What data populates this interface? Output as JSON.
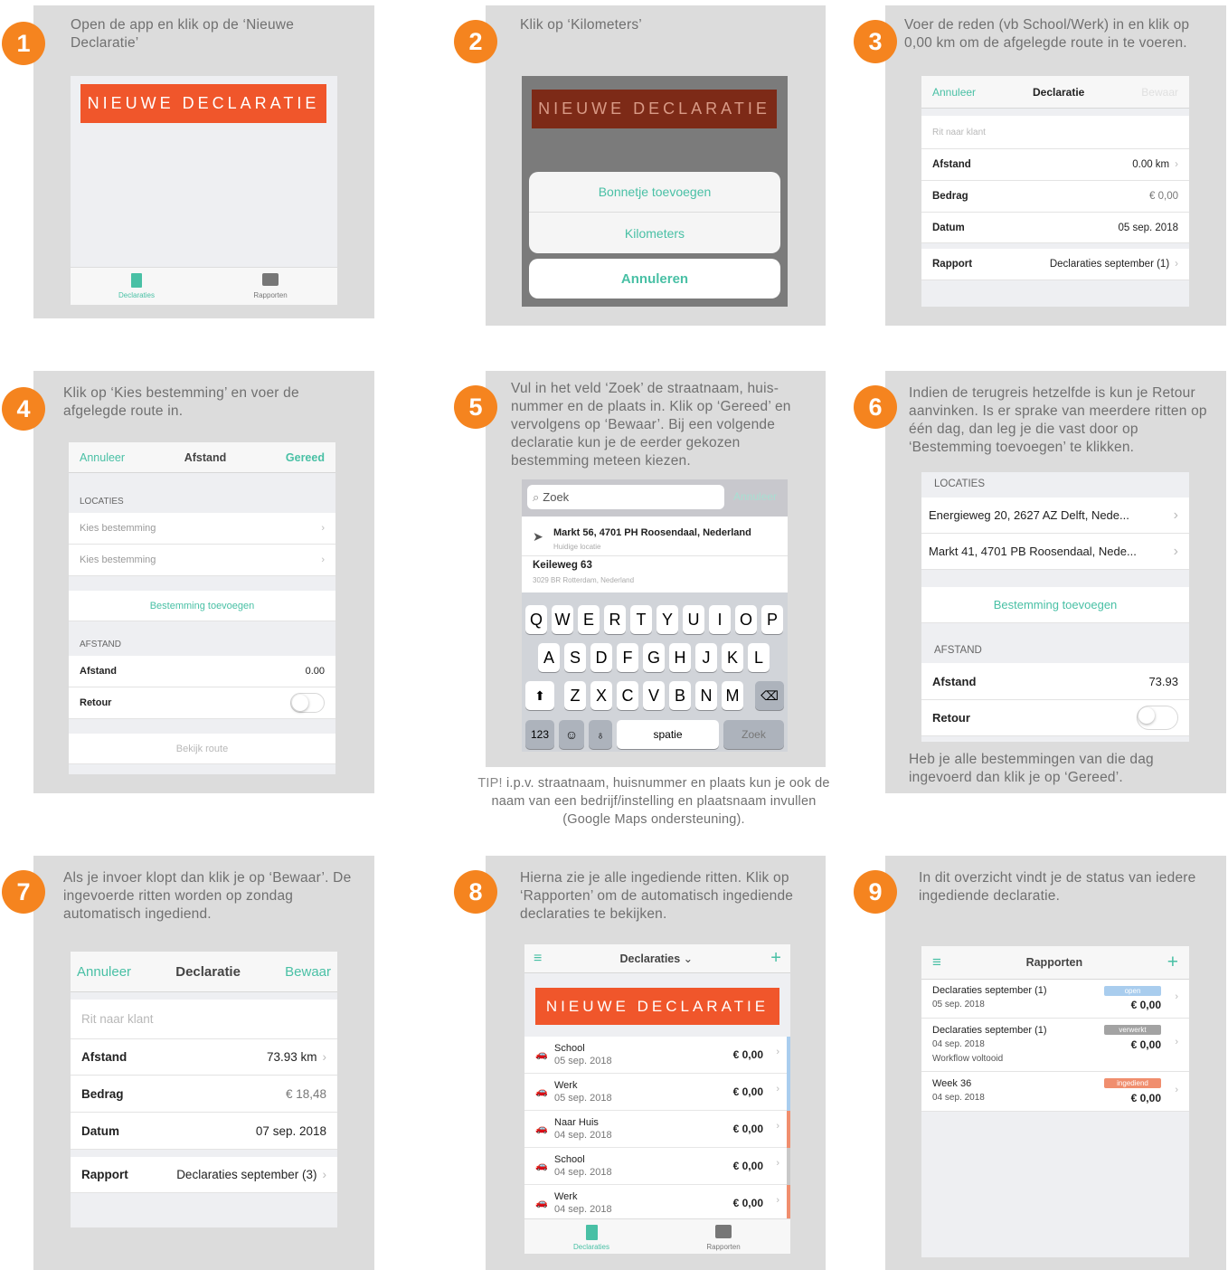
{
  "steps": [
    {
      "num": "1",
      "text": "Open de app en klik op de ‘Nieuwe Declaratie’"
    },
    {
      "num": "2",
      "text": "Klik op ‘Kilometers’"
    },
    {
      "num": "3",
      "text": "Voer de reden (vb School/Werk) in en klik op 0,00 km om de afgelegde route in te voeren."
    },
    {
      "num": "4",
      "text": "Klik op ‘Kies bestemming’ en voer de afgelegde route in."
    },
    {
      "num": "5",
      "text": "Vul in het veld ‘Zoek’ de straatnaam, huis-nummer en de plaats in. Klik op ‘Gereed’ en vervolgens op ‘Bewaar’. Bij een volgende declaratie kun je de eerder gekozen bestemming meteen kiezen."
    },
    {
      "num": "6",
      "text": "Indien de terugreis hetzelfde is kun je Retour aanvinken. Is er sprake van meerdere ritten op één dag, dan leg je die vast door op ‘Bestemming toevoegen’ te klikken.",
      "footer": "Heb je alle bestemmingen van die dag ingevoerd dan klik je op ‘Gereed’."
    },
    {
      "num": "7",
      "text": "Als je invoer klopt dan klik je op ‘Bewaar’. De ingevoerde ritten worden op zondag automatisch ingediend."
    },
    {
      "num": "8",
      "text": "Hierna zie je alle ingediende ritten. Klik op ‘Rapporten’ om de automatisch ingediende declaraties te bekijken."
    },
    {
      "num": "9",
      "text": "In dit overzicht vindt je de status van iedere ingediende declaratie."
    }
  ],
  "tip": {
    "bold": "TIP!",
    "text": " i.p.v. straatnaam, huisnummer en plaats kun je ook de naam van een bedrijf/instelling en plaatsnaam invullen (Google Maps ondersteuning)."
  },
  "app": {
    "new_btn": "NIEUWE DECLARATIE",
    "tab_declaraties": "Declaraties",
    "tab_rapporten": "Rapporten",
    "sheet": {
      "receipt": "Bonnetje toevoegen",
      "km": "Kilometers",
      "cancel": "Annuleren"
    },
    "form3": {
      "cancel": "Annuleer",
      "title": "Declaratie",
      "save": "Bewaar",
      "placeholder": "Rit naar klant",
      "afstand": "Afstand",
      "afstand_val": "0.00 km",
      "bedrag": "Bedrag",
      "bedrag_val": "€ 0,00",
      "datum": "Datum",
      "datum_val": "05 sep. 2018",
      "rapport": "Rapport",
      "rapport_val": "Declaraties september (1)"
    },
    "form4": {
      "cancel": "Annuleer",
      "title": "Afstand",
      "done": "Gereed",
      "locaties": "LOCATIES",
      "dest1": "Kies bestemming",
      "dest2": "Kies bestemming",
      "add": "Bestemming toevoegen",
      "afstand_h": "AFSTAND",
      "afstand": "Afstand",
      "afstand_val": "0.00",
      "retour": "Retour",
      "route": "Bekijk route"
    },
    "search5": {
      "placeholder": "Zoek",
      "cancel": "Annuleer",
      "r1": "Markt 56, 4701 PH Roosendaal, Nederland",
      "r1s": "Huidige locatie",
      "r2": "Keileweg 63",
      "r2s": "3029 BR Rotterdam, Nederland",
      "row1": [
        "Q",
        "W",
        "E",
        "R",
        "T",
        "Y",
        "U",
        "I",
        "O",
        "P"
      ],
      "row2": [
        "A",
        "S",
        "D",
        "F",
        "G",
        "H",
        "J",
        "K",
        "L"
      ],
      "row3": [
        "Z",
        "X",
        "C",
        "V",
        "B",
        "N",
        "M"
      ],
      "k123": "123",
      "space": "spatie",
      "search": "Zoek"
    },
    "form6": {
      "locaties": "LOCATIES",
      "loc1": "Energieweg 20, 2627 AZ Delft, Nede...",
      "loc2": "Markt 41, 4701 PB Roosendaal, Nede...",
      "add": "Bestemming toevoegen",
      "afstand_h": "AFSTAND",
      "afstand": "Afstand",
      "afstand_val": "73.93",
      "retour": "Retour"
    },
    "form7": {
      "cancel": "Annuleer",
      "title": "Declaratie",
      "save": "Bewaar",
      "placeholder": "Rit naar klant",
      "afstand": "Afstand",
      "afstand_val": "73.93 km",
      "bedrag": "Bedrag",
      "bedrag_val": "€ 18,48",
      "datum": "Datum",
      "datum_val": "07 sep. 2018",
      "rapport": "Rapport",
      "rapport_val": "Declaraties september (3)"
    },
    "list8": {
      "title": "Declaraties",
      "items": [
        {
          "name": "School",
          "date": "05 sep. 2018",
          "amount": "€ 0,00",
          "color": "#a9cdee"
        },
        {
          "name": "Werk",
          "date": "05 sep. 2018",
          "amount": "€ 0,00",
          "color": "#a9cdee"
        },
        {
          "name": "Naar Huis",
          "date": "04 sep. 2018",
          "amount": "€ 0,00",
          "color": "#f08e6e"
        },
        {
          "name": "School",
          "date": "04 sep. 2018",
          "amount": "€ 0,00",
          "color": "#c8c8c8"
        },
        {
          "name": "Werk",
          "date": "04 sep. 2018",
          "amount": "€ 0,00",
          "color": "#f08e6e"
        }
      ]
    },
    "reports9": {
      "title": "Rapporten",
      "items": [
        {
          "name": "Declaraties september (1)",
          "date": "05 sep. 2018",
          "status": "open",
          "status_color": "#a9cdee",
          "amount": "€ 0,00",
          "extra": ""
        },
        {
          "name": "Declaraties september (1)",
          "date": "04 sep. 2018",
          "status": "verwerkt",
          "status_color": "#a3a3a3",
          "amount": "€ 0,00",
          "extra": "Workflow voltooid"
        },
        {
          "name": "Week 36",
          "date": "04 sep. 2018",
          "status": "ingediend",
          "status_color": "#f08e6e",
          "amount": "€ 0,00",
          "extra": ""
        }
      ]
    }
  }
}
